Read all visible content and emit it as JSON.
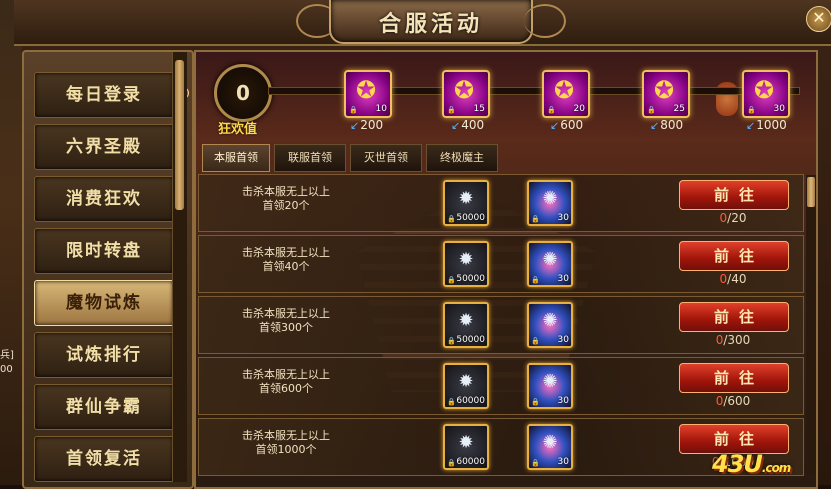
{
  "window": {
    "title": "合服活动",
    "close_label": "✕"
  },
  "world": {
    "left_text_1": "兵]",
    "left_text_2": "00"
  },
  "sidebar": {
    "items": [
      {
        "label": "每日登录",
        "active": false,
        "has_dot": true
      },
      {
        "label": "六界圣殿",
        "active": false
      },
      {
        "label": "消费狂欢",
        "active": false
      },
      {
        "label": "限时转盘",
        "active": false
      },
      {
        "label": "魔物试炼",
        "active": true
      },
      {
        "label": "试炼排行",
        "active": false
      },
      {
        "label": "群仙争霸",
        "active": false
      },
      {
        "label": "首领复活",
        "active": false
      }
    ]
  },
  "carnival": {
    "score": "0",
    "score_label": "狂欢值",
    "milestones": [
      {
        "count": "10",
        "value": "200"
      },
      {
        "count": "15",
        "value": "400"
      },
      {
        "count": "20",
        "value": "600"
      },
      {
        "count": "25",
        "value": "800"
      },
      {
        "count": "30",
        "value": "1000"
      }
    ]
  },
  "tabs": [
    {
      "label": "本服首领",
      "active": true
    },
    {
      "label": "联服首领",
      "active": false
    },
    {
      "label": "灭世首领",
      "active": false
    },
    {
      "label": "终极魔主",
      "active": false
    }
  ],
  "tasks": [
    {
      "desc_line1": "击杀本服无上以上",
      "desc_line2": "首领20个",
      "reward1": "50000",
      "reward2": "30",
      "button": "前往",
      "current": "0",
      "total": "/20"
    },
    {
      "desc_line1": "击杀本服无上以上",
      "desc_line2": "首领40个",
      "reward1": "50000",
      "reward2": "30",
      "button": "前往",
      "current": "0",
      "total": "/40"
    },
    {
      "desc_line1": "击杀本服无上以上",
      "desc_line2": "首领300个",
      "reward1": "50000",
      "reward2": "30",
      "button": "前往",
      "current": "0",
      "total": "/300"
    },
    {
      "desc_line1": "击杀本服无上以上",
      "desc_line2": "首领600个",
      "reward1": "60000",
      "reward2": "30",
      "button": "前往",
      "current": "0",
      "total": "/600"
    },
    {
      "desc_line1": "击杀本服无上以上",
      "desc_line2": "首领1000个",
      "reward1": "60000",
      "reward2": "30",
      "button": "前往",
      "current": "0",
      "total": "/1000"
    }
  ],
  "watermark": {
    "main": "43U",
    "suffix": ".com"
  },
  "icons": {
    "milestone": "treasure-bag-icon",
    "reward1": "crystal-orb-icon",
    "reward2": "fireworks-icon",
    "lock": "lock-icon",
    "arrow": "blue-arrow-icon"
  }
}
